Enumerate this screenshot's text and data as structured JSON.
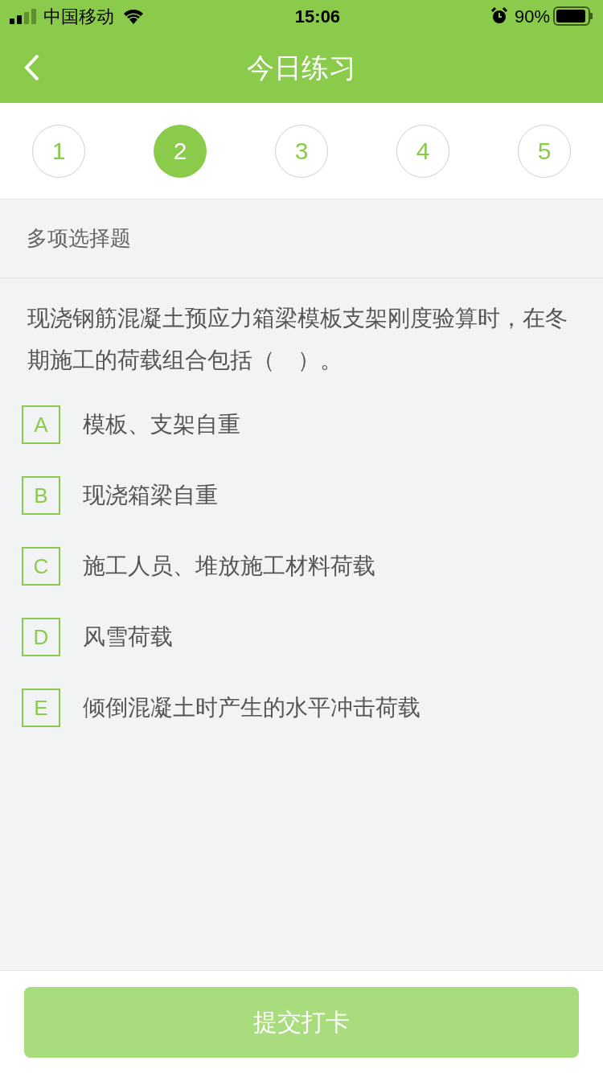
{
  "status_bar": {
    "carrier": "中国移动",
    "time": "15:06",
    "battery": "90%"
  },
  "nav": {
    "title": "今日练习"
  },
  "tabs": [
    {
      "label": "1",
      "selected": false
    },
    {
      "label": "2",
      "selected": true
    },
    {
      "label": "3",
      "selected": false
    },
    {
      "label": "4",
      "selected": false
    },
    {
      "label": "5",
      "selected": false
    }
  ],
  "question": {
    "type_label": "多项选择题",
    "text": "现浇钢筋混凝土预应力箱梁模板支架刚度验算时，在冬期施工的荷载组合包括（　）。",
    "options": [
      {
        "letter": "A",
        "text": "模板、支架自重",
        "selected": false
      },
      {
        "letter": "B",
        "text": "现浇箱梁自重",
        "selected": false
      },
      {
        "letter": "C",
        "text": "施工人员、堆放施工材料荷载",
        "selected": false
      },
      {
        "letter": "D",
        "text": "风雪荷载",
        "selected": false
      },
      {
        "letter": "E",
        "text": "倾倒混凝土时产生的水平冲击荷载",
        "selected": false
      }
    ]
  },
  "submit": {
    "label": "提交打卡",
    "disabled": true
  }
}
